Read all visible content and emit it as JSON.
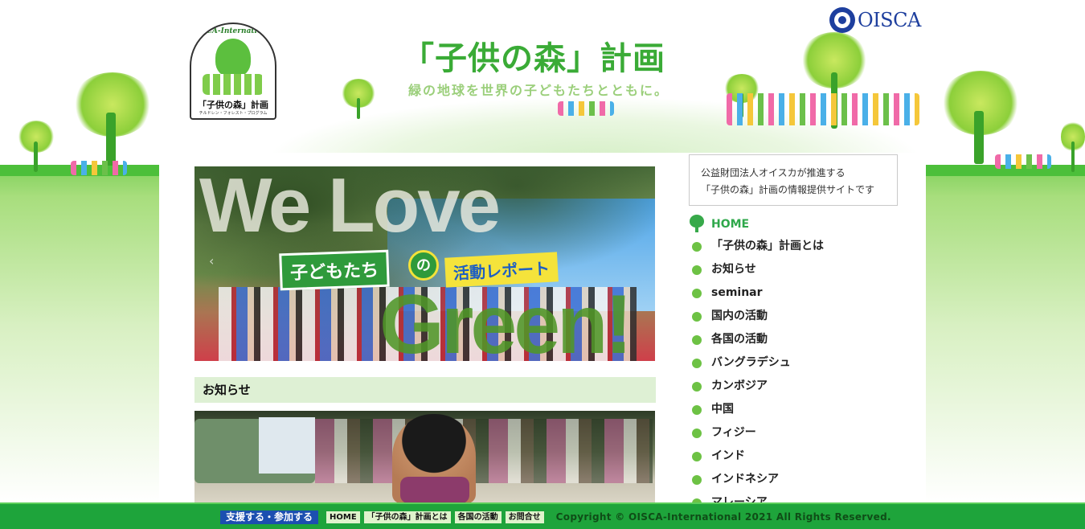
{
  "header": {
    "logo": {
      "arc_text": "OISCA-International",
      "name": "「子供の森」計画",
      "sub": "チルドレン・フォレスト・プログラム"
    },
    "title": "「子供の森」計画",
    "tagline": "緑の地球を世界の子どもたちとともに。",
    "org_logo_text": "OISCA"
  },
  "hero": {
    "headline_top": "We Love",
    "headline_bottom": "Green!",
    "chip_children": "子どもたち",
    "chip_no": "の",
    "chip_report": "活動レポート",
    "prev_arrow": "‹"
  },
  "main": {
    "notice_heading": "お知らせ"
  },
  "sidebar": {
    "intro_line1": "公益財団法人オイスカが推進する",
    "intro_line2": "「子供の森」計画の情報提供サイトです",
    "home_label": "HOME",
    "items": [
      {
        "label": "「子供の森」計画とは"
      },
      {
        "label": "お知らせ"
      },
      {
        "label": "seminar"
      },
      {
        "label": "国内の活動"
      },
      {
        "label": "各国の活動"
      },
      {
        "label": "バングラデシュ"
      },
      {
        "label": "カンボジア"
      },
      {
        "label": "中国"
      },
      {
        "label": "フィジー"
      },
      {
        "label": "インド"
      },
      {
        "label": "インドネシア"
      },
      {
        "label": "マレーシア"
      }
    ]
  },
  "footer": {
    "support_label": "支援する・参加する",
    "nav": [
      {
        "label": "HOME"
      },
      {
        "label": "「子供の森」計画とは"
      },
      {
        "label": "各国の活動"
      },
      {
        "label": "お問合せ"
      }
    ],
    "copyright": "Copyright © OISCA-International 2021 All Rights Reserved."
  },
  "colors": {
    "brand_green": "#3aab36",
    "nav_dot": "#6dc244",
    "footer_bg": "#1ea43b",
    "support_blue": "#1c4fb0"
  },
  "icons": [
    "tree-logo-icon",
    "oisca-logo-icon",
    "tree-home-icon",
    "bullet-dot-icon",
    "prev-arrow-icon"
  ]
}
